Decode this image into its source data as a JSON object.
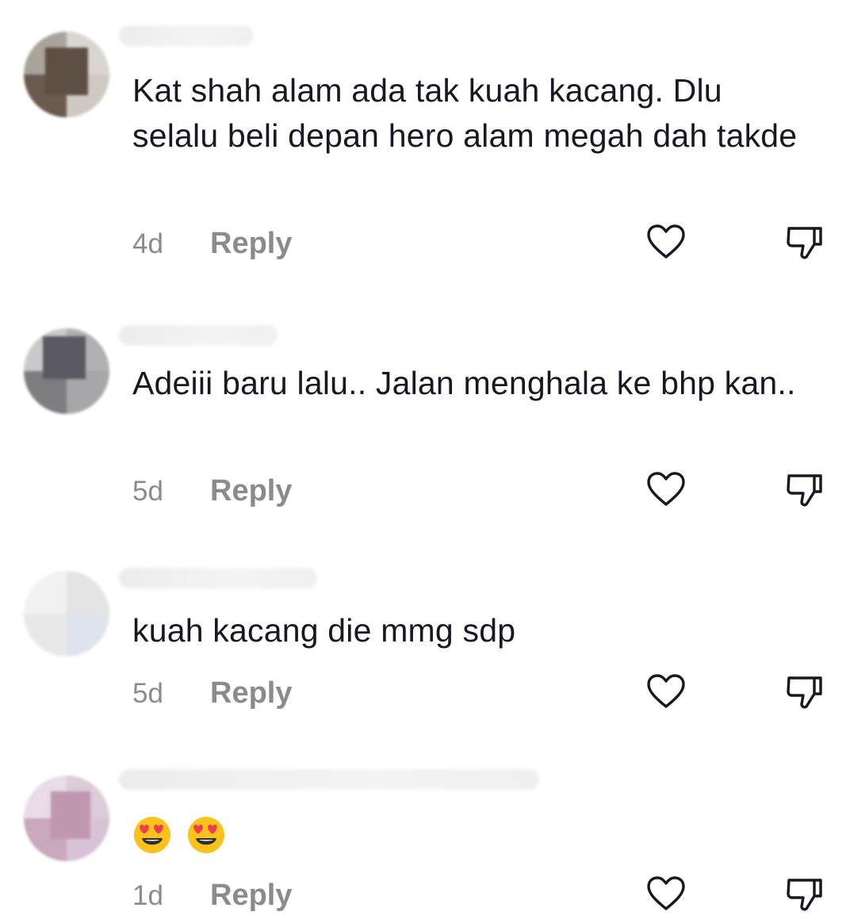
{
  "comments": [
    {
      "text": "Kat shah alam ada tak kuah kacang. Dlu selalu beli depan hero alam megah dah takde",
      "time": "4d",
      "reply_label": "Reply"
    },
    {
      "text": "Adeiii baru lalu.. Jalan menghala ke bhp kan..",
      "time": "5d",
      "reply_label": "Reply"
    },
    {
      "text": "kuah kacang die mmg sdp",
      "time": "5d",
      "reply_label": "Reply"
    },
    {
      "text": "",
      "emojis": [
        "heart-eyes-emoji",
        "heart-eyes-emoji"
      ],
      "time": "1d",
      "reply_label": "Reply"
    }
  ],
  "icons": {
    "like": "heart-outline-icon",
    "dislike": "thumbs-down-outline-icon"
  },
  "colors": {
    "text": "#161823",
    "secondary": "#8a8b91",
    "emoji_face": "#fcc21b",
    "emoji_heart": "#ed3b4f"
  }
}
